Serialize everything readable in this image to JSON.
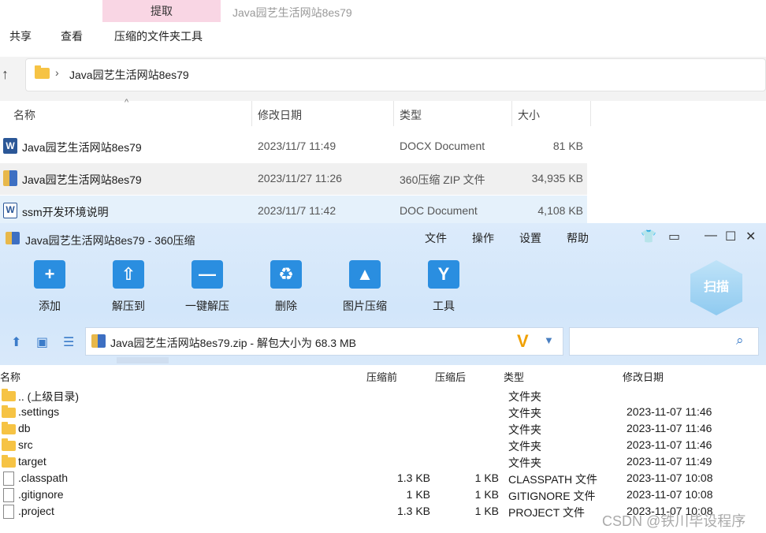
{
  "explorer": {
    "ribbon": {
      "extract_tab": "提取",
      "window_title": "Java园艺生活网站8es79",
      "items": [
        "共享",
        "查看",
        "压缩的文件夹工具"
      ]
    },
    "address": {
      "path": "Java园艺生活网站8es79",
      "chevron": "›",
      "up": "↑"
    },
    "columns": [
      "名称",
      "修改日期",
      "类型",
      "大小"
    ],
    "rows": [
      {
        "name": "Java园艺生活网站8es79",
        "date": "2023/11/7 11:49",
        "type": "DOCX Document",
        "size": "81 KB",
        "icon": "word-icon",
        "icon_glyph": "W"
      },
      {
        "name": "Java园艺生活网站8es79",
        "date": "2023/11/27 11:26",
        "type": "360压缩 ZIP 文件",
        "size": "34,935 KB",
        "icon": "zip-icon",
        "icon_glyph": ""
      },
      {
        "name": "ssm开发环境说明",
        "date": "2023/11/7 11:42",
        "type": "DOC Document",
        "size": "4,108 KB",
        "icon": "doc-icon",
        "icon_glyph": "W"
      }
    ]
  },
  "zip360": {
    "title": "Java园艺生活网站8es79 - 360压缩",
    "menu": [
      "文件",
      "操作",
      "设置",
      "帮助"
    ],
    "window_controls": {
      "skin": "👕",
      "feedback": "▭",
      "minimize": "—",
      "maximize": "☐",
      "close": "✕"
    },
    "tools": [
      {
        "label": "添加",
        "glyph": "+"
      },
      {
        "label": "解压到",
        "glyph": "⇧"
      },
      {
        "label": "一键解压",
        "glyph": "—"
      },
      {
        "label": "删除",
        "glyph": "♻"
      },
      {
        "label": "图片压缩",
        "glyph": "▲"
      },
      {
        "label": "工具",
        "glyph": "Y"
      }
    ],
    "scan_label": "扫描",
    "path_text": "Java园艺生活网站8es79.zip - 解包大小为 68.3 MB",
    "v_logo": "V",
    "dropdown": "▼",
    "search_glyph": "⌕",
    "nav": {
      "up": "⬆",
      "view": "▣",
      "list": "☰"
    },
    "columns": {
      "name": "名称",
      "before": "压缩前",
      "after": "压缩后",
      "type": "类型",
      "date": "修改日期"
    },
    "files": [
      {
        "name": ".. (上级目录)",
        "before": "",
        "after": "",
        "type": "文件夹",
        "date": "",
        "kind": "folder"
      },
      {
        "name": ".settings",
        "before": "",
        "after": "",
        "type": "文件夹",
        "date": "2023-11-07 11:46",
        "kind": "folder"
      },
      {
        "name": "db",
        "before": "",
        "after": "",
        "type": "文件夹",
        "date": "2023-11-07 11:46",
        "kind": "folder"
      },
      {
        "name": "src",
        "before": "",
        "after": "",
        "type": "文件夹",
        "date": "2023-11-07 11:46",
        "kind": "folder"
      },
      {
        "name": "target",
        "before": "",
        "after": "",
        "type": "文件夹",
        "date": "2023-11-07 11:49",
        "kind": "folder"
      },
      {
        "name": ".classpath",
        "before": "1.3 KB",
        "after": "1 KB",
        "type": "CLASSPATH 文件",
        "date": "2023-11-07 10:08",
        "kind": "file"
      },
      {
        "name": ".gitignore",
        "before": "1 KB",
        "after": "1 KB",
        "type": "GITIGNORE 文件",
        "date": "2023-11-07 10:08",
        "kind": "file"
      },
      {
        "name": ".project",
        "before": "1.3 KB",
        "after": "1 KB",
        "type": "PROJECT 文件",
        "date": "2023-11-07 10:08",
        "kind": "file"
      }
    ]
  },
  "watermark": "CSDN @铁川毕设程序"
}
